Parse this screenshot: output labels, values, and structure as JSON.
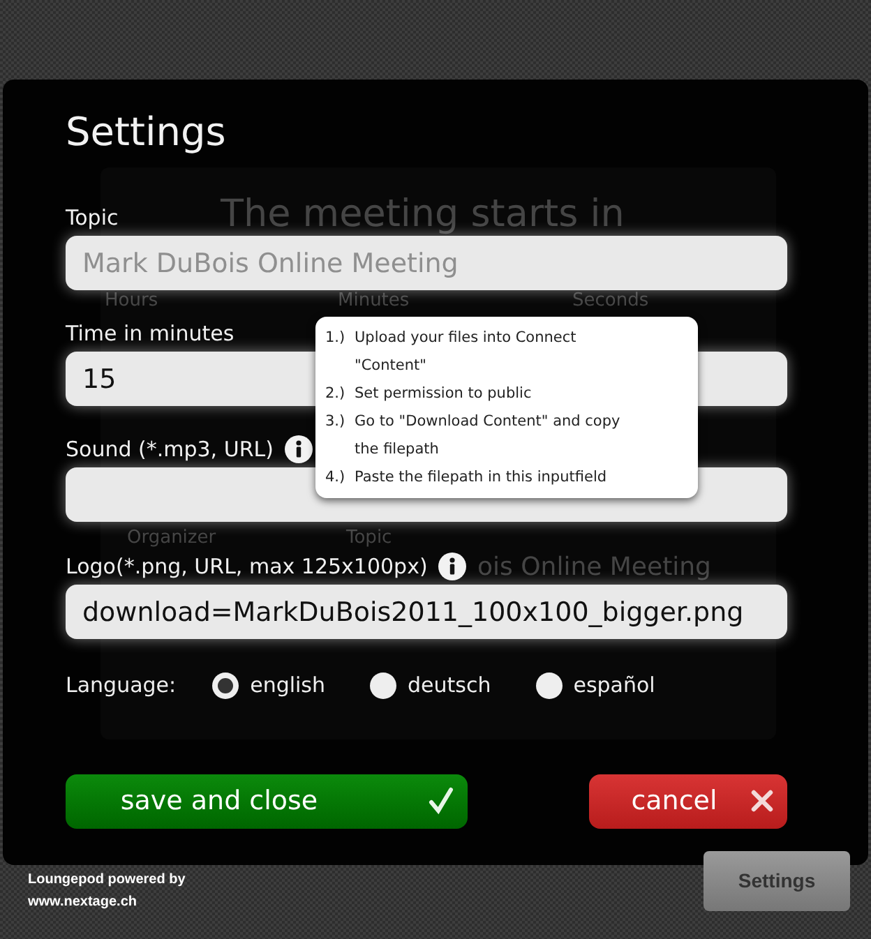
{
  "backdrop": {
    "heading": "The meeting starts in",
    "units": [
      "Hours",
      "Minutes",
      "Seconds"
    ],
    "labels": [
      "Organizer",
      "Topic"
    ],
    "topic_value": "ois Online Meeting"
  },
  "dialog": {
    "title": "Settings",
    "fields": [
      {
        "label": "Topic",
        "placeholder": "Mark DuBois Online Meeting",
        "info": false
      },
      {
        "label": "Time in minutes",
        "value": "15",
        "info": false
      },
      {
        "label": "Sound (*.mp3, URL)",
        "info": true
      },
      {
        "label": "Logo(*.png, URL, max 125x100px)",
        "value": "download=MarkDuBois2011_100x100_bigger.png",
        "info": true
      }
    ],
    "tooltip": {
      "items": [
        {
          "number": "1.)",
          "text": "Upload your files into Connect \"Content\""
        },
        {
          "number": "2.)",
          "text": "Set permission to public"
        },
        {
          "number": "3.)",
          "text": "Go to \"Download Content\" and copy the filepath"
        },
        {
          "number": "4.)",
          "text": "Paste the filepath in this inputfield"
        }
      ]
    },
    "language": {
      "label": "Language:",
      "options": [
        {
          "label": "english",
          "selected": true
        },
        {
          "label": "deutsch",
          "selected": false
        },
        {
          "label": "español",
          "selected": false
        }
      ]
    },
    "buttons": [
      {
        "kind": "save",
        "label": "save and close"
      },
      {
        "kind": "cancel",
        "label": "cancel"
      }
    ]
  },
  "footer": {
    "credit": "Loungepod powered by",
    "link": "www.nextage.ch",
    "settings_button": "Settings"
  }
}
